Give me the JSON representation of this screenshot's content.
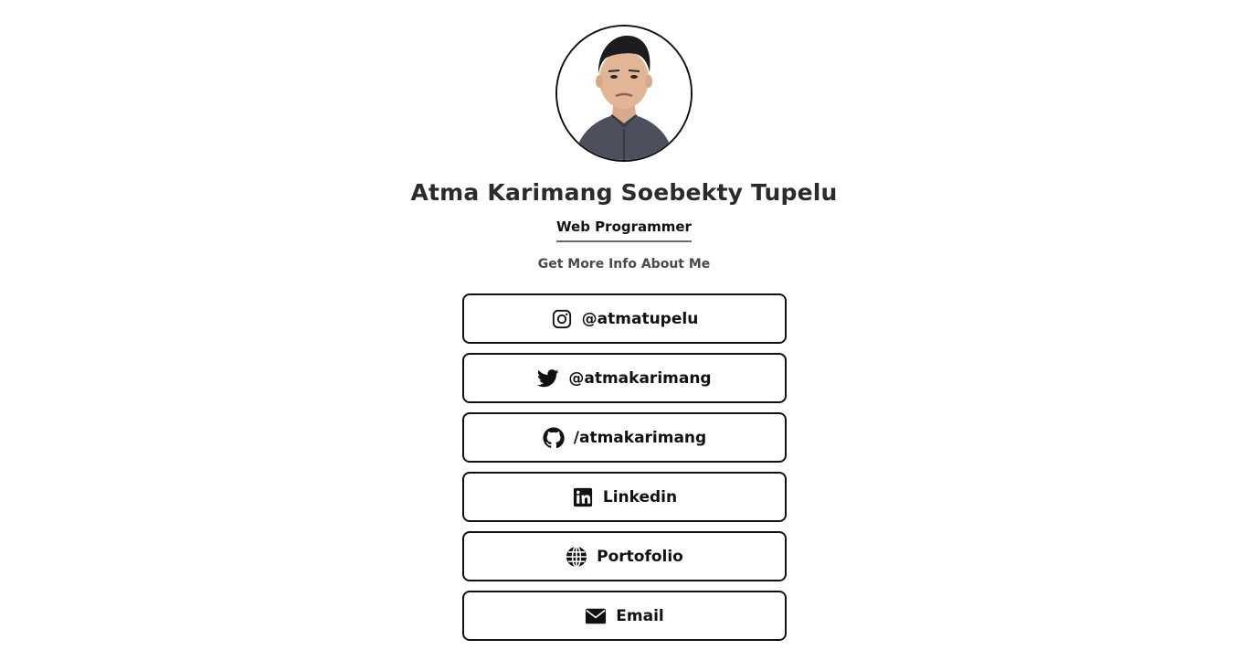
{
  "profile": {
    "name": "Atma Karimang Soebekty Tupelu",
    "role": "Web Programmer",
    "more_info": "Get More Info About Me"
  },
  "links": [
    {
      "icon": "instagram-icon",
      "label": "@atmatupelu"
    },
    {
      "icon": "twitter-icon",
      "label": "@atmakarimang"
    },
    {
      "icon": "github-icon",
      "label": "/atmakarimang"
    },
    {
      "icon": "linkedin-icon",
      "label": "Linkedin"
    },
    {
      "icon": "globe-icon",
      "label": "Portofolio"
    },
    {
      "icon": "envelope-icon",
      "label": "Email"
    }
  ],
  "colors": {
    "text": "#222222",
    "border": "#111111",
    "background": "#ffffff"
  }
}
